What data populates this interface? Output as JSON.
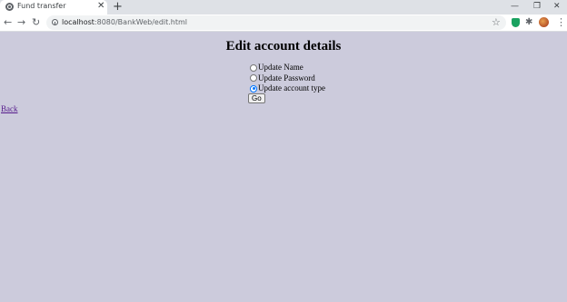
{
  "browser": {
    "tab_title": "Fund transfer",
    "tab_close": "✕",
    "new_tab": "+",
    "window_controls": {
      "minimize": "—",
      "maximize": "❐",
      "close": "✕"
    },
    "nav": {
      "back": "←",
      "forward": "→",
      "reload": "↻"
    },
    "url_host": "localhost",
    "url_path": ":8080/BankWeb/edit.html",
    "bookmark_icon": "☆",
    "extensions_icon": "✱",
    "menu_icon": "⋮"
  },
  "page": {
    "heading": "Edit account details",
    "options": [
      {
        "label": "Update Name",
        "checked": false
      },
      {
        "label": "Update Password",
        "checked": false
      },
      {
        "label": "Update account type",
        "checked": true
      }
    ],
    "go_label": "Go",
    "back_label": "Back"
  },
  "colors": {
    "page_background": "#cccbdc",
    "link": "#551a8b",
    "radio_checked": "#0075ff"
  }
}
